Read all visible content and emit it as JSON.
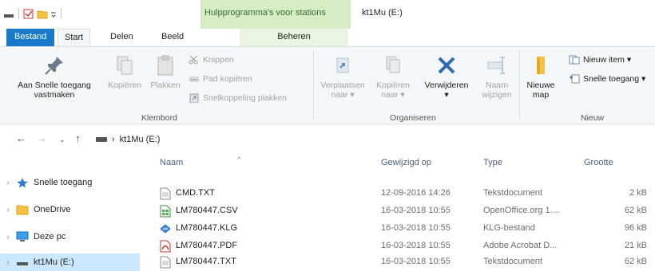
{
  "window": {
    "title": "kt1Mu (E:)",
    "context_group": "Hulpprogramma's voor stations"
  },
  "tabs": {
    "file": "Bestand",
    "start": "Start",
    "delen": "Delen",
    "beeld": "Beeld",
    "beheren": "Beheren"
  },
  "ribbon": {
    "pin_label_1": "Aan Snelle toegang",
    "pin_label_2": "vastmaken",
    "copy": "Kopiëren",
    "paste": "Plakken",
    "cut": "Knippen",
    "copy_path": "Pad kopiëren",
    "paste_shortcut": "Snelkoppeling plakken",
    "move_to_1": "Verplaatsen",
    "move_to_2": "naar ▾",
    "copy_to_1": "Kopiëren",
    "copy_to_2": "naar ▾",
    "delete": "Verwijderen",
    "rename_1": "Naam",
    "rename_2": "wijzigen",
    "new_folder_1": "Nieuwe",
    "new_folder_2": "map",
    "new_item": "Nieuw item ▾",
    "easy_access": "Snelle toegang ▾",
    "group_clipboard": "Klembord",
    "group_organize": "Organiseren",
    "group_new": "Nieuw"
  },
  "address": {
    "separator": "›",
    "location": "kt1Mu (E:)"
  },
  "nav": {
    "quick_access": "Snelle toegang",
    "onedrive": "OneDrive",
    "this_pc": "Deze pc",
    "drive": "kt1Mu (E:)"
  },
  "columns": {
    "name": "Naam",
    "modified": "Gewijzigd op",
    "type": "Type",
    "size": "Grootte"
  },
  "files": [
    {
      "name": "CMD.TXT",
      "modified": "12-09-2016 14:26",
      "type": "Tekstdocument",
      "size": "2 kB",
      "icon": "text-file-icon"
    },
    {
      "name": "LM780447.CSV",
      "modified": "16-03-2018 10:55",
      "type": "OpenOffice.org 1....",
      "size": "62 kB",
      "icon": "spreadsheet-file-icon"
    },
    {
      "name": "LM780447.KLG",
      "modified": "16-03-2018 10:55",
      "type": "KLG-bestand",
      "size": "96 kB",
      "icon": "klg-file-icon"
    },
    {
      "name": "LM780447.PDF",
      "modified": "16-03-2018 10:55",
      "type": "Adobe Acrobat D...",
      "size": "21 kB",
      "icon": "pdf-file-icon"
    },
    {
      "name": "LM780447.TXT",
      "modified": "16-03-2018 10:55",
      "type": "Tekstdocument",
      "size": "62 kB",
      "icon": "text-file-icon"
    }
  ],
  "colors": {
    "file_tab": "#1979ca",
    "context_group": "#d6ecc4",
    "selected_nav": "#cce8ff",
    "delete_icon": "#2b6cb0"
  }
}
